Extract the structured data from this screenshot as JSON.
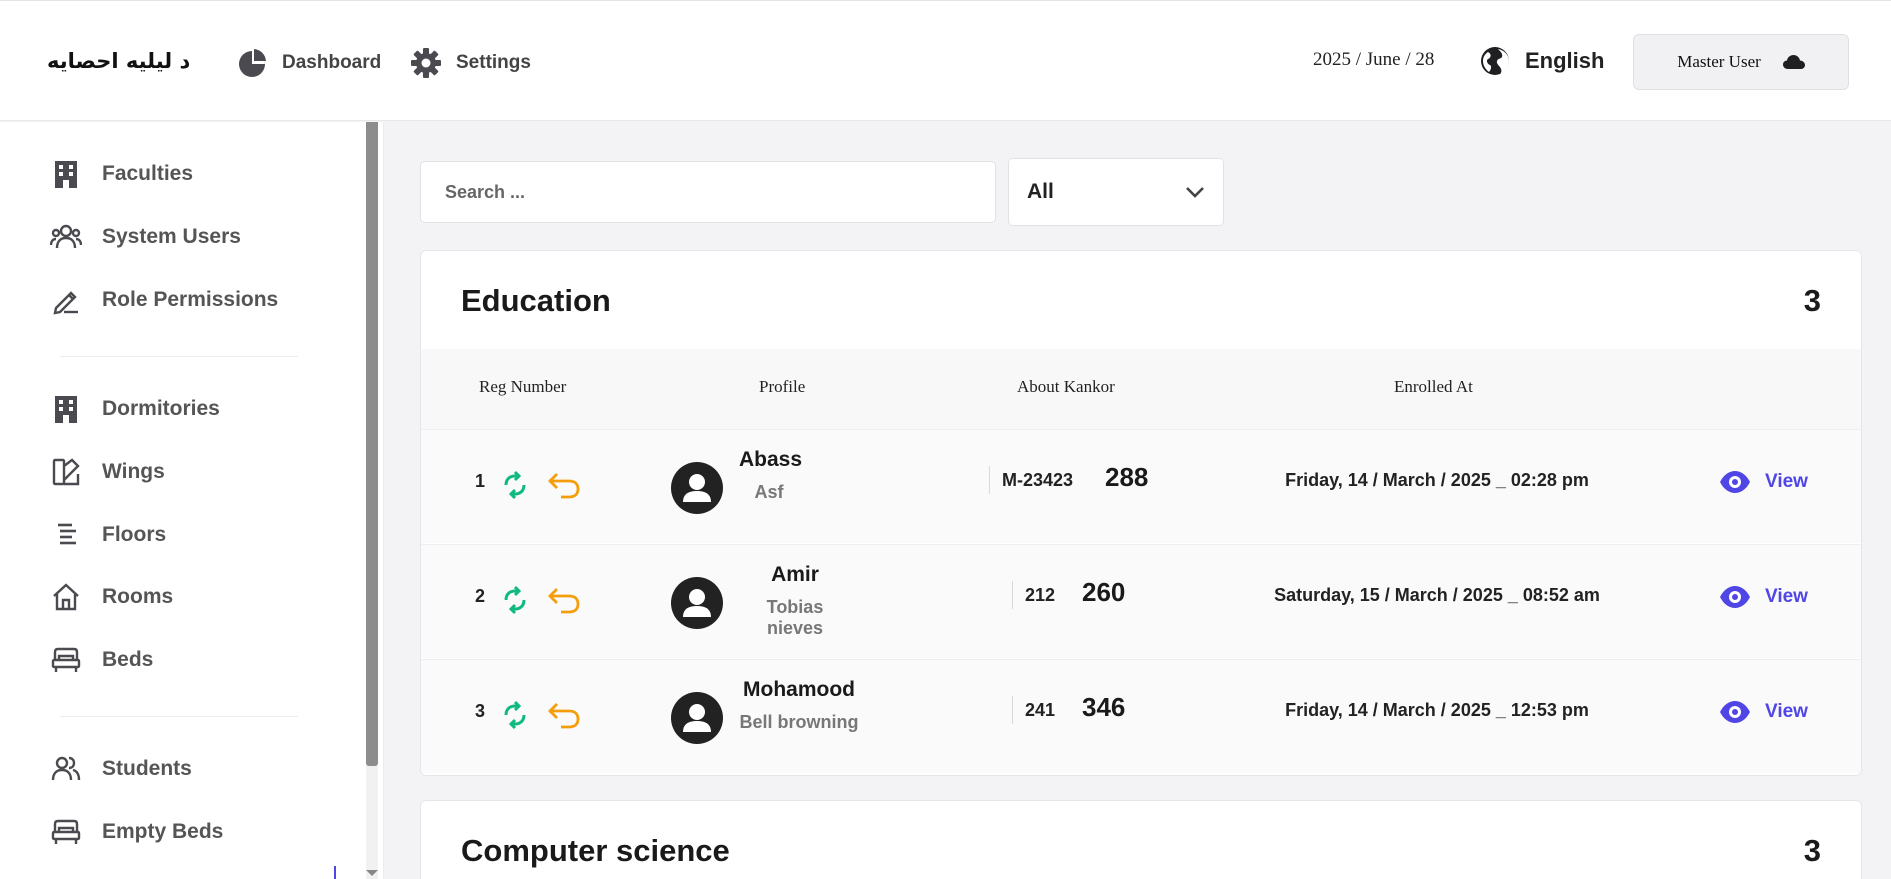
{
  "header": {
    "brand": "د لیلیه احصایه",
    "nav": [
      {
        "label": "Dashboard",
        "icon": "pie-chart-icon"
      },
      {
        "label": "Settings",
        "icon": "gear-icon"
      }
    ],
    "date": "2025 / June / 28",
    "language": "English",
    "user": "Master User"
  },
  "sidebar": {
    "groups": [
      [
        {
          "label": "Faculties",
          "icon": "building-icon"
        },
        {
          "label": "System Users",
          "icon": "users-icon"
        },
        {
          "label": "Role Permissions",
          "icon": "pen-icon"
        }
      ],
      [
        {
          "label": "Dormitories",
          "icon": "building-icon"
        },
        {
          "label": "Wings",
          "icon": "wings-icon"
        },
        {
          "label": "Floors",
          "icon": "floors-icon"
        },
        {
          "label": "Rooms",
          "icon": "home-icon"
        },
        {
          "label": "Beds",
          "icon": "bed-icon"
        }
      ],
      [
        {
          "label": "Students",
          "icon": "students-icon"
        },
        {
          "label": "Empty Beds",
          "icon": "bed-icon"
        }
      ]
    ]
  },
  "filters": {
    "search_placeholder": "Search ...",
    "select_value": "All"
  },
  "table_headers": {
    "reg": "Reg Number",
    "profile": "Profile",
    "kankor": "About Kankor",
    "enrolled": "Enrolled At"
  },
  "sections": [
    {
      "title": "Education",
      "count": "3",
      "rows": [
        {
          "reg": "1",
          "name": "Abass",
          "sub": "Asf",
          "code": "M-23423",
          "score": "288",
          "enrolled": "Friday, 14 / March / 2025 _ 02:28 pm",
          "action": "View"
        },
        {
          "reg": "2",
          "name": "Amir",
          "sub": "Tobias nieves",
          "code": "212",
          "score": "260",
          "enrolled": "Saturday, 15 / March / 2025 _ 08:52 am",
          "action": "View"
        },
        {
          "reg": "3",
          "name": "Mohamood",
          "sub": "Bell browning",
          "code": "241",
          "score": "346",
          "enrolled": "Friday, 14 / March / 2025 _ 12:53 pm",
          "action": "View"
        }
      ]
    },
    {
      "title": "Computer science",
      "count": "3"
    }
  ],
  "colors": {
    "accent": "#4f46e5",
    "refresh": "#10b981",
    "undo": "#f59e0b"
  }
}
